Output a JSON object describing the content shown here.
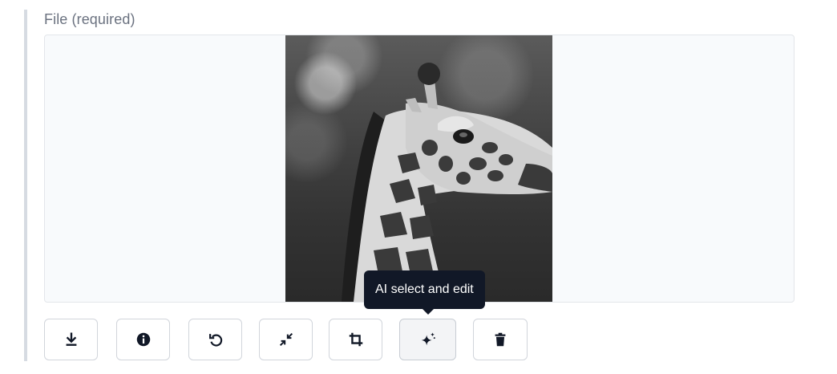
{
  "field": {
    "label": "File (required)"
  },
  "image": {
    "subject": "giraffe",
    "style": "black-and-white"
  },
  "toolbar": {
    "buttons": [
      {
        "name": "download-button",
        "icon": "download-icon"
      },
      {
        "name": "info-button",
        "icon": "info-icon"
      },
      {
        "name": "reset-button",
        "icon": "undo-icon"
      },
      {
        "name": "minimize-button",
        "icon": "minimize-arrows-icon"
      },
      {
        "name": "crop-button",
        "icon": "crop-icon"
      },
      {
        "name": "ai-edit-button",
        "icon": "sparkles-icon"
      },
      {
        "name": "delete-button",
        "icon": "trash-icon"
      }
    ]
  },
  "tooltip": {
    "text": "AI select and edit"
  },
  "colors": {
    "icon": "#111827",
    "tooltip_bg": "#111827",
    "border": "#d1d5db",
    "left_rule": "#d6dbe2",
    "label": "#6b7280"
  }
}
